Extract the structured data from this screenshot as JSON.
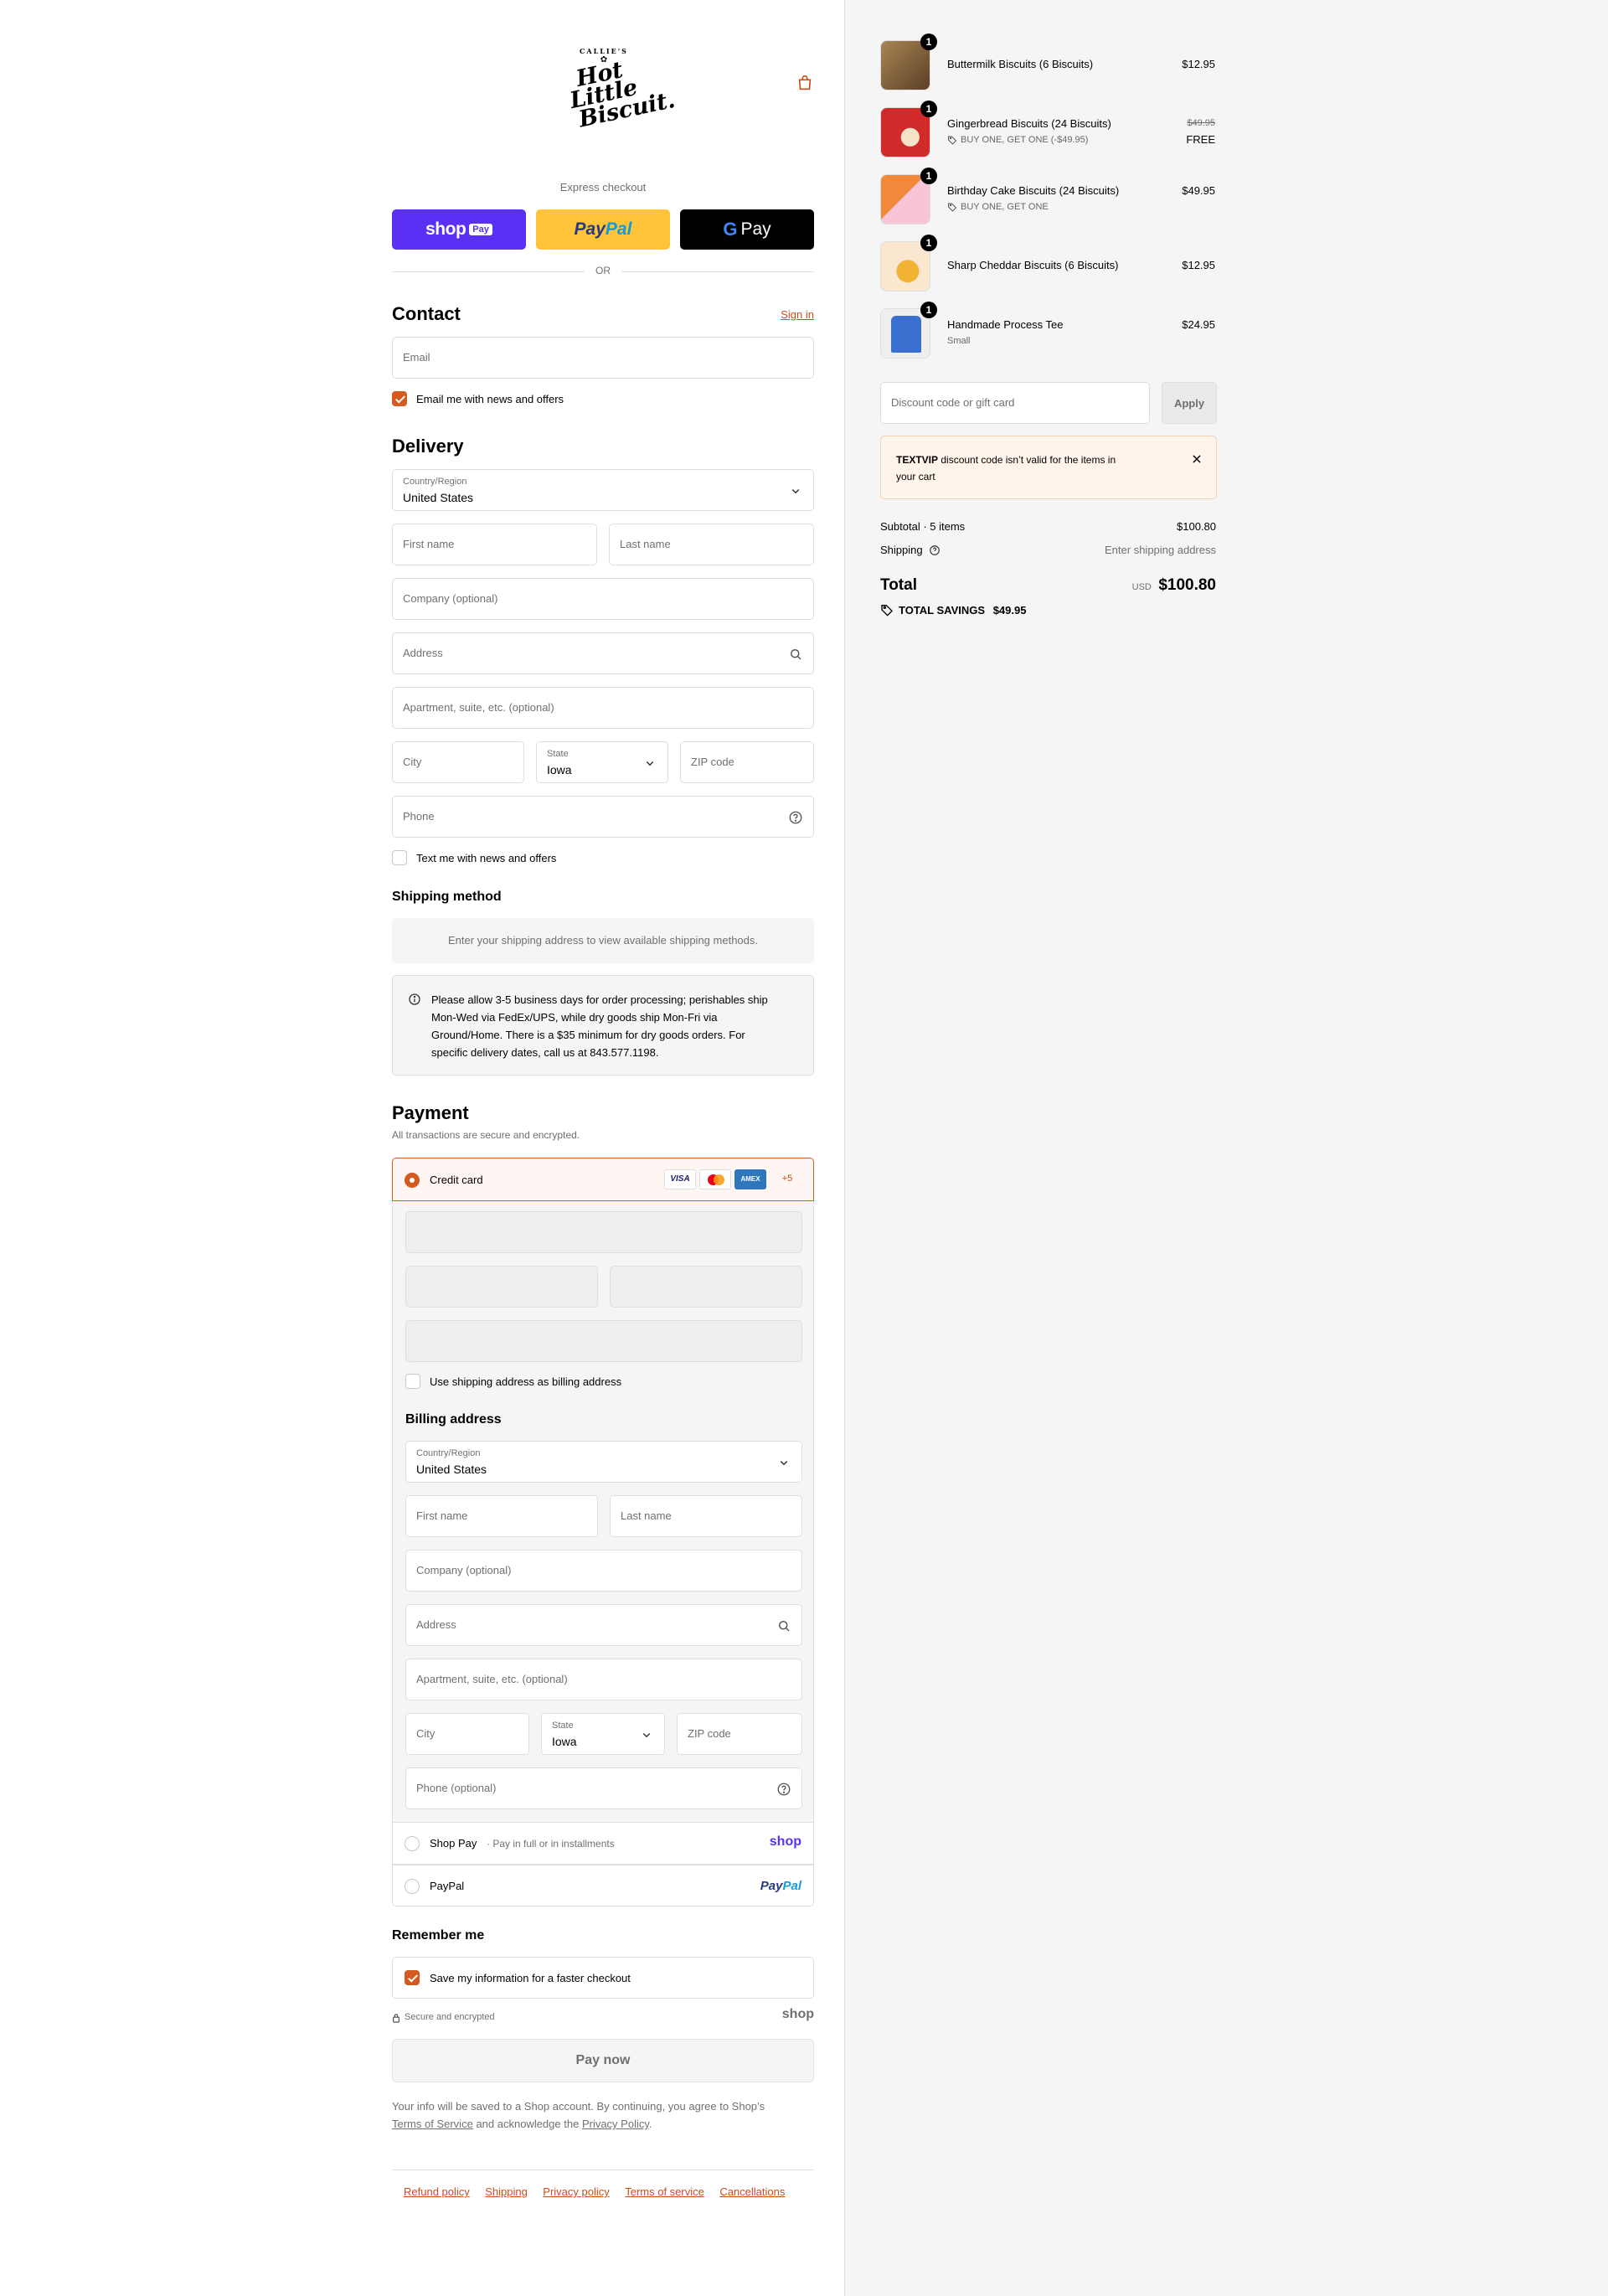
{
  "brand": {
    "top": "CALLIE'S",
    "line1": "Hot Little",
    "line2": "Biscuit."
  },
  "express": {
    "label": "Express checkout",
    "or": "OR",
    "shop_pay": "shop",
    "shop_pay_tag": "Pay",
    "paypal_1": "Pay",
    "paypal_2": "Pal",
    "gpay": "Pay"
  },
  "contact": {
    "title": "Contact",
    "sign_in": "Sign in",
    "email_placeholder": "Email",
    "news_label": "Email me with news and offers"
  },
  "delivery": {
    "title": "Delivery",
    "country_label": "Country/Region",
    "country_value": "United States",
    "first_name": "First name",
    "last_name": "Last name",
    "company": "Company (optional)",
    "address": "Address",
    "apartment": "Apartment, suite, etc. (optional)",
    "city": "City",
    "state_label": "State",
    "state_value": "Iowa",
    "zip": "ZIP code",
    "phone": "Phone",
    "text_label": "Text me with news and offers"
  },
  "shipping": {
    "title": "Shipping method",
    "placeholder": "Enter your shipping address to view available shipping methods.",
    "note_lines": [
      "Please allow 3-5 business days for order processing; perishables ship",
      "Mon-Wed via FedEx/UPS, while dry goods ship Mon-Fri via",
      "Ground/Home. There is a $35 minimum for dry goods orders. For",
      "specific delivery dates, call us at 843.577.1198."
    ]
  },
  "payment": {
    "title": "Payment",
    "subtitle": "All transactions are secure and encrypted.",
    "credit_card": "Credit card",
    "visa": "VISA",
    "amex": "AMEX",
    "more": "+5",
    "use_shipping": "Use shipping address as billing address",
    "billing_title": "Billing address",
    "country_label": "Country/Region",
    "country_value": "United States",
    "first_name": "First name",
    "last_name": "Last name",
    "company": "Company (optional)",
    "address": "Address",
    "apartment": "Apartment, suite, etc. (optional)",
    "city": "City",
    "state_label": "State",
    "state_value": "Iowa",
    "zip": "ZIP code",
    "phone": "Phone (optional)",
    "shop_pay": "Shop Pay",
    "shop_pay_sub": "Pay in full or in installments",
    "shop_logo": "shop",
    "paypal": "PayPal",
    "paypal_logo_1": "Pay",
    "paypal_logo_2": "Pal"
  },
  "remember": {
    "title": "Remember me",
    "save_label": "Save my information for a faster checkout",
    "secure": "Secure and encrypted",
    "shop_logo": "shop"
  },
  "pay_now": "Pay now",
  "legal": {
    "line1": "Your info will be saved to a Shop account. By continuing, you agree to Shop’s",
    "terms": "Terms of Service",
    "mid": "and acknowledge the",
    "privacy": "Privacy Policy",
    "end": "."
  },
  "footer_links": [
    "Refund policy",
    "Shipping",
    "Privacy policy",
    "Terms of service",
    "Cancellations"
  ],
  "cart": {
    "items": [
      {
        "qty": "1",
        "name": "Buttermilk Biscuits (6 Biscuits)",
        "sub": "",
        "price": "$12.95",
        "old": "",
        "thumb": "#8a6a3d"
      },
      {
        "qty": "1",
        "name": "Gingerbread Biscuits (24 Biscuits)",
        "sub": "BUY ONE, GET ONE (-$49.95)",
        "price": "FREE",
        "old": "$49.95",
        "thumb": "#d12a2a"
      },
      {
        "qty": "1",
        "name": "Birthday Cake Biscuits (24 Biscuits)",
        "sub": "BUY ONE, GET ONE",
        "price": "$49.95",
        "old": "",
        "thumb": "#f08a3a"
      },
      {
        "qty": "1",
        "name": "Sharp Cheddar Biscuits (6 Biscuits)",
        "sub": "",
        "price": "$12.95",
        "old": "",
        "thumb": "#e87a2a"
      },
      {
        "qty": "1",
        "name": "Handmade Process Tee",
        "sub": "Small",
        "price": "$24.95",
        "old": "",
        "thumb": "#3a6fd0"
      }
    ],
    "discount_placeholder": "Discount code or gift card",
    "apply": "Apply",
    "error_code": "TEXTVIP",
    "error_rest": "discount code isn’t valid for the items in",
    "error_line2": "your cart",
    "subtotal_label": "Subtotal · 5 items",
    "subtotal": "$100.80",
    "shipping_label": "Shipping",
    "shipping_value": "Enter shipping address",
    "total_label": "Total",
    "currency": "USD",
    "total": "$100.80",
    "savings_label": "TOTAL SAVINGS",
    "savings": "$49.95"
  }
}
